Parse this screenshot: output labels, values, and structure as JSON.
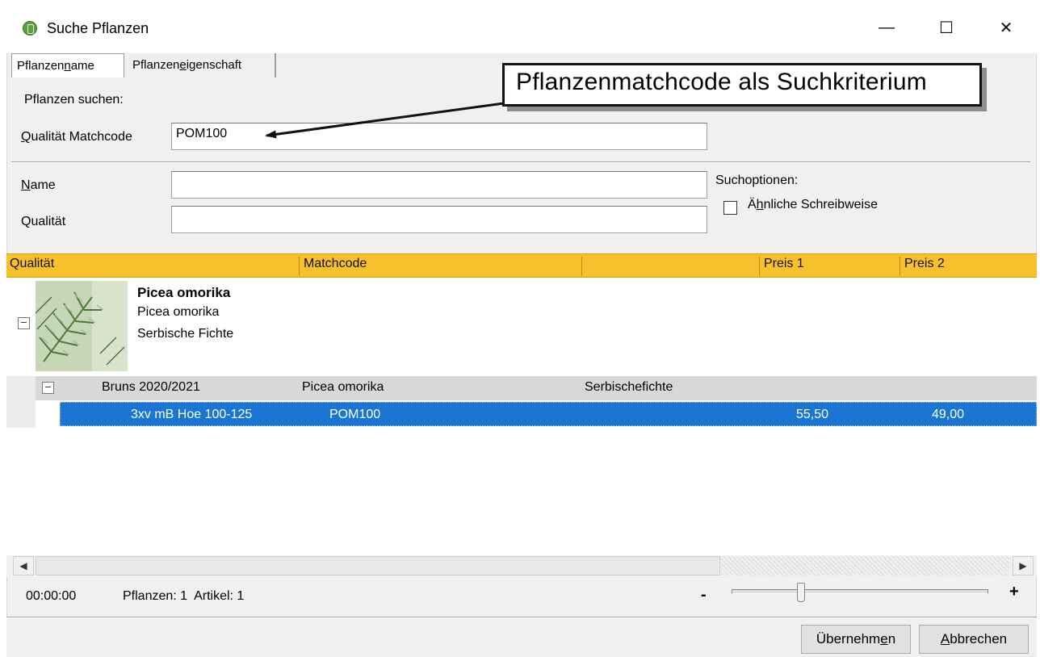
{
  "window": {
    "title": "Suche Pflanzen",
    "controls": {
      "minimize": "—",
      "maximize": "☐",
      "close": "✕"
    }
  },
  "tabs": [
    {
      "label_pre": "Pflanzen",
      "label_acc": "n",
      "label_post": "ame",
      "active": true
    },
    {
      "label_pre": "Pflanzen",
      "label_acc": "e",
      "label_post": "igenschaft",
      "active": false
    }
  ],
  "callout": {
    "text": "Pflanzenmatchcode als Suchkriterium"
  },
  "search": {
    "section_label": "Pflanzen suchen:",
    "matchcode_label_acc": "Q",
    "matchcode_label_rest": "ualität Matchcode",
    "matchcode_value": "POM100",
    "name_label_acc": "N",
    "name_label_rest": "ame",
    "name_value": "",
    "quality_label": "Qualität",
    "quality_value": ""
  },
  "options": {
    "title": "Suchoptionen:",
    "similar_pre": "Ä",
    "similar_acc": "h",
    "similar_post": "nliche Schreibweise",
    "similar_checked": false
  },
  "grid": {
    "columns": [
      "Qualität",
      "Matchcode",
      "",
      "Preis 1",
      "Preis 2"
    ],
    "plant": {
      "name": "Picea omorika",
      "botanical": "Picea omorika",
      "common": "Serbische Fichte",
      "expand_glyph": "−"
    },
    "group": {
      "catalog": "Bruns 2020/2021",
      "botanical": "Picea omorika",
      "common": "Serbischefichte",
      "expand_glyph": "−"
    },
    "article": {
      "quality": "3xv mB Hoe 100-125",
      "matchcode": "POM100",
      "price1": "55,50",
      "price2": "49,00"
    }
  },
  "scrollbar": {
    "left_arrow": "◀",
    "right_arrow": "▶"
  },
  "status": {
    "time": "00:00:00",
    "counts": "Pflanzen: 1  Artikel: 1",
    "zoom_minus": "-",
    "zoom_plus": "+",
    "zoom_level": 0.27
  },
  "buttons": {
    "ok_pre": "Übernehm",
    "ok_acc": "e",
    "ok_post": "n",
    "cancel_acc": "A",
    "cancel_post": "bbrechen"
  },
  "colors": {
    "grid_header": "#f7c12d",
    "selection": "#1a76d2",
    "group_row": "#d8d8d8"
  }
}
